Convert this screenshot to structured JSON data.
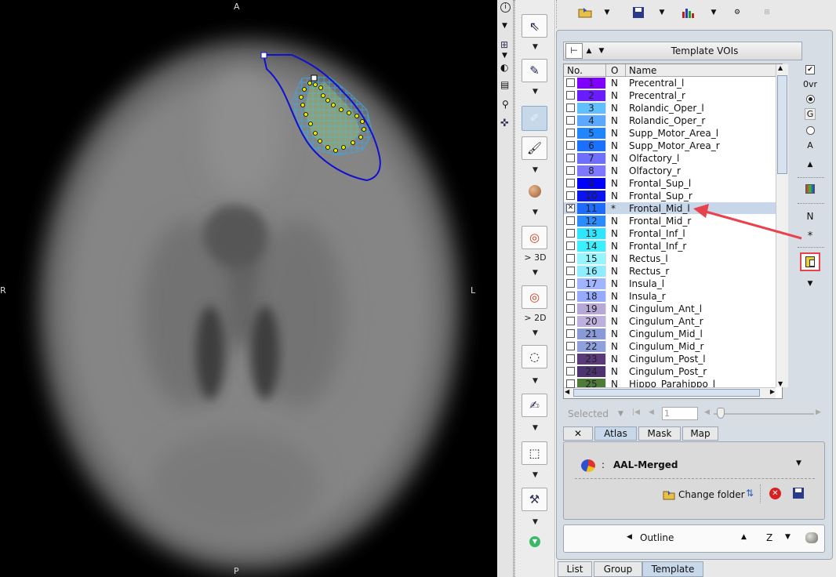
{
  "viewer": {
    "orient_top": "A",
    "orient_bottom": "P",
    "orient_left": "R",
    "orient_right": "L"
  },
  "tools": {
    "label_3d": "> 3D",
    "label_2d": "> 2D"
  },
  "template_vois": {
    "title": "Template VOIs",
    "columns": [
      "No.",
      "O",
      "Name"
    ],
    "rows": [
      {
        "no": "1",
        "o": "N",
        "name": "Precentral_l",
        "color": "#7f00ff",
        "checked": false
      },
      {
        "no": "2",
        "o": "N",
        "name": "Precentral_r",
        "color": "#6a1bff",
        "checked": false
      },
      {
        "no": "3",
        "o": "N",
        "name": "Rolandic_Oper_l",
        "color": "#5fbfff",
        "checked": false
      },
      {
        "no": "4",
        "o": "N",
        "name": "Rolandic_Oper_r",
        "color": "#5aa8ff",
        "checked": false
      },
      {
        "no": "5",
        "o": "N",
        "name": "Supp_Motor_Area_l",
        "color": "#1f86ff",
        "checked": false
      },
      {
        "no": "6",
        "o": "N",
        "name": "Supp_Motor_Area_r",
        "color": "#1a70ff",
        "checked": false
      },
      {
        "no": "7",
        "o": "N",
        "name": "Olfactory_l",
        "color": "#6e6eff",
        "checked": false
      },
      {
        "no": "8",
        "o": "N",
        "name": "Olfactory_r",
        "color": "#7d78ff",
        "checked": false
      },
      {
        "no": "9",
        "o": "N",
        "name": "Frontal_Sup_l",
        "color": "#0000ff",
        "checked": false
      },
      {
        "no": "10",
        "o": "N",
        "name": "Frontal_Sup_r",
        "color": "#0a14f0",
        "checked": false
      },
      {
        "no": "11",
        "o": "*",
        "name": "Frontal_Mid_l",
        "color": "#1e6cff",
        "checked": true
      },
      {
        "no": "12",
        "o": "N",
        "name": "Frontal_Mid_r",
        "color": "#2a8cff",
        "checked": false
      },
      {
        "no": "13",
        "o": "N",
        "name": "Frontal_Inf_l",
        "color": "#2ee6ff",
        "checked": false
      },
      {
        "no": "14",
        "o": "N",
        "name": "Frontal_Inf_r",
        "color": "#3af0ff",
        "checked": false
      },
      {
        "no": "15",
        "o": "N",
        "name": "Rectus_l",
        "color": "#96f6ff",
        "checked": false
      },
      {
        "no": "16",
        "o": "N",
        "name": "Rectus_r",
        "color": "#8ceeff",
        "checked": false
      },
      {
        "no": "17",
        "o": "N",
        "name": "Insula_l",
        "color": "#a0b4ff",
        "checked": false
      },
      {
        "no": "18",
        "o": "N",
        "name": "Insula_r",
        "color": "#96aaff",
        "checked": false
      },
      {
        "no": "19",
        "o": "N",
        "name": "Cingulum_Ant_l",
        "color": "#b8a8d8",
        "checked": false
      },
      {
        "no": "20",
        "o": "N",
        "name": "Cingulum_Ant_r",
        "color": "#beb0dc",
        "checked": false
      },
      {
        "no": "21",
        "o": "N",
        "name": "Cingulum_Mid_l",
        "color": "#8a9ad8",
        "checked": false
      },
      {
        "no": "22",
        "o": "N",
        "name": "Cingulum_Mid_r",
        "color": "#90a0dc",
        "checked": false
      },
      {
        "no": "23",
        "o": "N",
        "name": "Cingulum_Post_l",
        "color": "#5a3a78",
        "checked": false
      },
      {
        "no": "24",
        "o": "N",
        "name": "Cingulum_Post_r",
        "color": "#4e3270",
        "checked": false
      },
      {
        "no": "25",
        "o": "N",
        "name": "Hippo_Parahippo_l",
        "color": "#4e7a3a",
        "checked": false
      }
    ],
    "side": {
      "ovr_label": "0vr",
      "g_label": "G",
      "a_label": "A",
      "n_label": "N",
      "star_label": "*"
    }
  },
  "selection_bar": {
    "selected_label": "Selected",
    "index_value": "1"
  },
  "tabs": [
    "Atlas",
    "Mask",
    "Map"
  ],
  "atlas": {
    "separator": ":",
    "name": "AAL-Merged",
    "change_folder": "Change folder"
  },
  "outline": {
    "label": "Outline",
    "axis": "Z"
  },
  "bottom_tabs": [
    "List",
    "Group",
    "Template"
  ],
  "colors": {
    "accent": "#c6d8ea",
    "arrow_red": "#e8424c",
    "voi_outline": "#1010d0"
  }
}
